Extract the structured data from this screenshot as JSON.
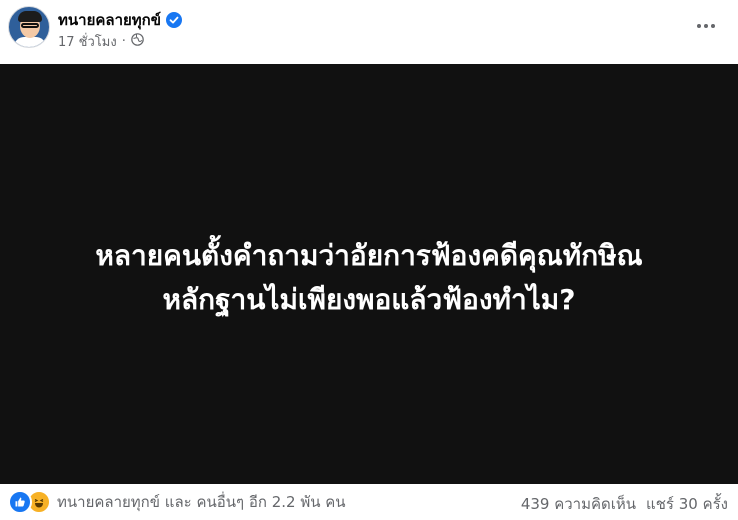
{
  "post": {
    "page_name": "ทนายคลายทุกข์",
    "time_ago": "17 ชั่วโมง",
    "separator": "·",
    "verified_icon": "verified-badge-icon",
    "privacy_icon": "globe-icon",
    "more_icon": "more-options-icon"
  },
  "media": {
    "background": "#111111",
    "lines": [
      "หลายคนตั้งคำถามว่าอัยการฟ้องคดีคุณทักษิณ",
      "หลักฐานไม่เพียงพอแล้วฟ้องทำไม?"
    ]
  },
  "footer": {
    "reaction_icons": [
      "like-icon",
      "haha-icon"
    ],
    "reaction_summary": "ทนายคลายทุกข์ และ คนอื่นๆ อีก 2.2 พัน คน",
    "comments": "439 ความคิดเห็น",
    "shares": "แชร์ 30 ครั้ง"
  },
  "colors": {
    "accent": "#1877f2",
    "secondary_text": "#65676b",
    "haha": "#f7b125"
  }
}
